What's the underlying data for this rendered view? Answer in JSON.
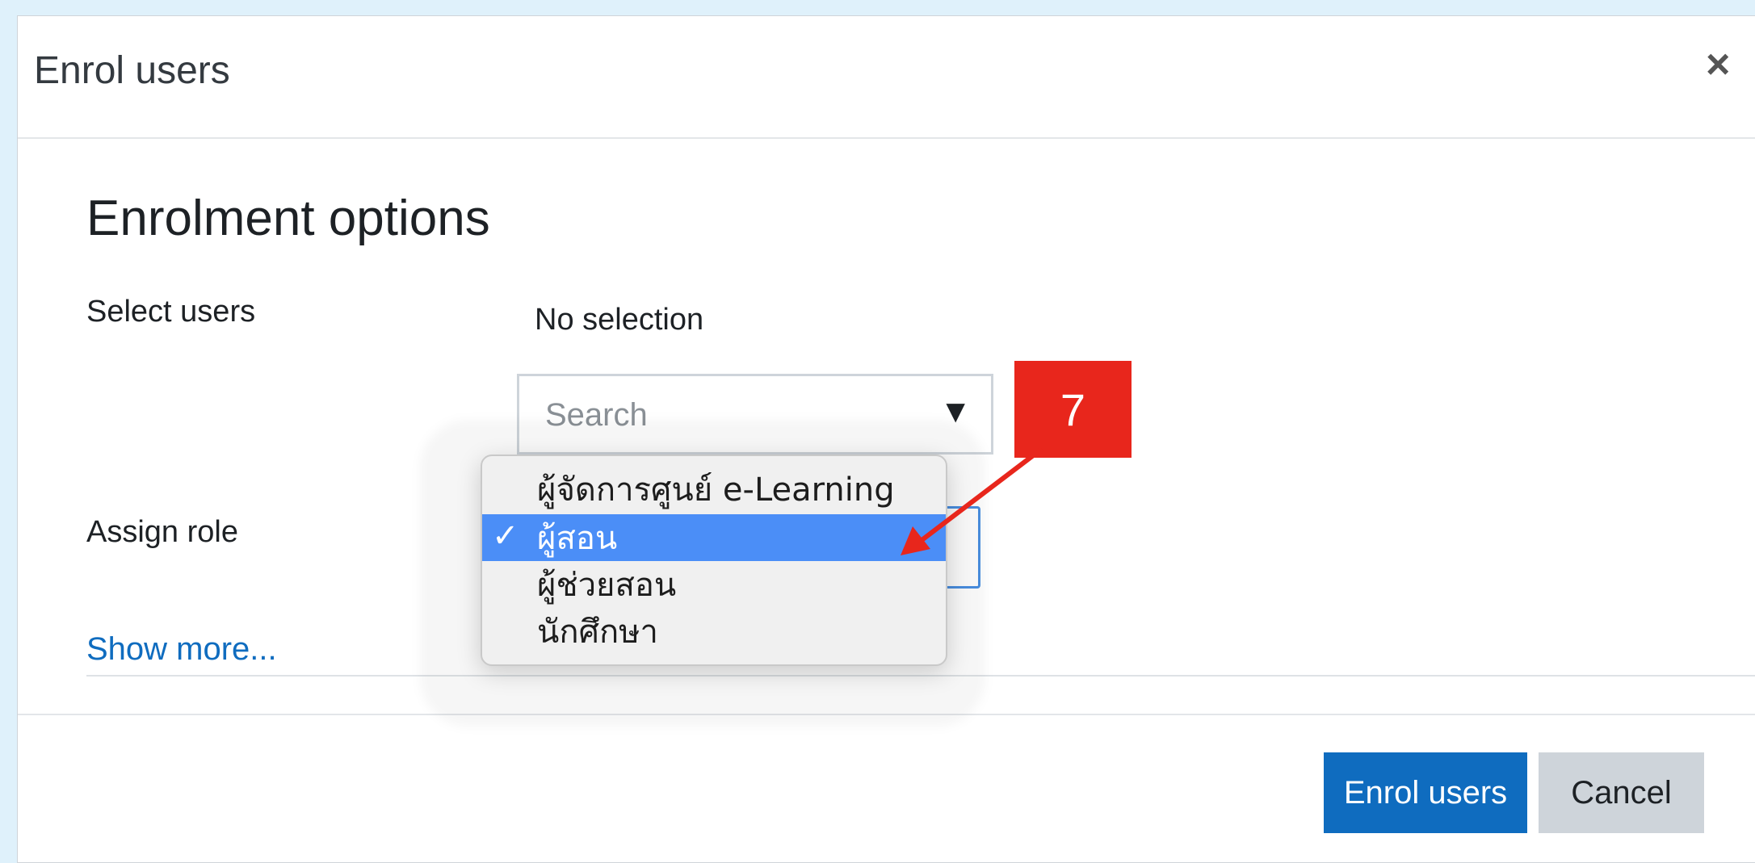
{
  "dialog": {
    "title": "Enrol users",
    "close_symbol": "×"
  },
  "enrolment": {
    "section_title": "Enrolment options",
    "select_users_label": "Select users",
    "selection_status": "No selection",
    "search": {
      "placeholder": "Search",
      "dropdown_symbol": "▼"
    },
    "assign_role_label": "Assign role",
    "role_options": [
      {
        "label": "ผู้จัดการศูนย์ e-Learning",
        "selected": false
      },
      {
        "label": "ผู้สอน",
        "selected": true
      },
      {
        "label": "ผู้ช่วยสอน",
        "selected": false
      },
      {
        "label": "นักศึกษา",
        "selected": false
      }
    ],
    "check_symbol": "✓",
    "show_more": "Show more..."
  },
  "footer": {
    "enrol_button": "Enrol users",
    "cancel_button": "Cancel"
  },
  "annotation": {
    "step_number": "7",
    "color": "#e8261c"
  },
  "colors": {
    "primary": "#0f6cbf",
    "selected_option": "#4b8ef7",
    "backdrop": "#dff1fb"
  },
  "icons": {
    "close": "close-icon",
    "dropdown": "chevron-down-icon",
    "check": "checkmark-icon",
    "annotation_arrow": "arrow-icon"
  }
}
